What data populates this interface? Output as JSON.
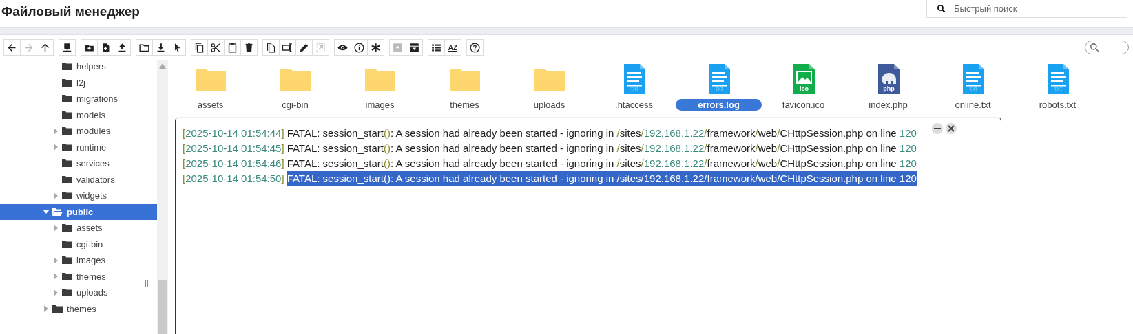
{
  "header": {
    "title": "Файловый менеджер",
    "search": {
      "placeholder": "Быстрый поиск"
    }
  },
  "toolbar": {
    "groups": [
      [
        {
          "kind": "back",
          "disabled": false
        },
        {
          "kind": "forward",
          "disabled": true
        },
        {
          "kind": "up",
          "disabled": false
        }
      ],
      [
        {
          "kind": "network",
          "disabled": false
        }
      ],
      [
        {
          "kind": "new-folder",
          "disabled": false
        },
        {
          "kind": "new-file",
          "disabled": false
        },
        {
          "kind": "upload",
          "disabled": false
        }
      ],
      [
        {
          "kind": "open",
          "disabled": false
        },
        {
          "kind": "download",
          "disabled": false
        },
        {
          "kind": "select",
          "disabled": false
        }
      ],
      [
        {
          "kind": "copy",
          "disabled": false
        },
        {
          "kind": "cut",
          "disabled": false
        },
        {
          "kind": "paste",
          "disabled": false
        },
        {
          "kind": "delete",
          "disabled": false
        }
      ],
      [
        {
          "kind": "duplicate",
          "disabled": false
        },
        {
          "kind": "rename",
          "disabled": false
        },
        {
          "kind": "edit",
          "disabled": false
        },
        {
          "kind": "resize",
          "disabled": true
        }
      ],
      [
        {
          "kind": "view",
          "disabled": false
        },
        {
          "kind": "info",
          "disabled": false
        },
        {
          "kind": "asterisk",
          "disabled": false
        }
      ],
      [
        {
          "kind": "archive",
          "disabled": true
        },
        {
          "kind": "extract",
          "disabled": false
        }
      ],
      [
        {
          "kind": "list",
          "disabled": false
        },
        {
          "kind": "sort",
          "label": "AZ",
          "disabled": false
        }
      ],
      [
        {
          "kind": "help",
          "disabled": false
        }
      ]
    ]
  },
  "tree": {
    "items": [
      {
        "children": [
          {
            "label": "helpers",
            "expandable": false,
            "expanded": false,
            "selected": false
          },
          {
            "label": "l2j",
            "expandable": false,
            "expanded": false,
            "selected": false
          },
          {
            "label": "migrations",
            "expandable": false,
            "expanded": false,
            "selected": false
          },
          {
            "label": "models",
            "expandable": false,
            "expanded": false,
            "selected": false
          },
          {
            "label": "modules",
            "expandable": true,
            "expanded": false,
            "selected": false
          },
          {
            "label": "runtime",
            "expandable": true,
            "expanded": false,
            "selected": false
          },
          {
            "label": "services",
            "expandable": false,
            "expanded": false,
            "selected": false
          },
          {
            "label": "validators",
            "expandable": false,
            "expanded": false,
            "selected": false
          },
          {
            "label": "widgets",
            "expandable": true,
            "expanded": false,
            "selected": false
          }
        ]
      },
      {
        "label": "public",
        "expandable": true,
        "expanded": true,
        "selected": true,
        "children": [
          {
            "label": "assets",
            "expandable": true,
            "expanded": false,
            "selected": false
          },
          {
            "label": "cgi-bin",
            "expandable": false,
            "expanded": false,
            "selected": false
          },
          {
            "label": "images",
            "expandable": true,
            "expanded": false,
            "selected": false
          },
          {
            "label": "themes",
            "expandable": true,
            "expanded": false,
            "selected": false
          },
          {
            "label": "uploads",
            "expandable": true,
            "expanded": false,
            "selected": false
          }
        ]
      },
      {
        "label": "themes",
        "expandable": true,
        "expanded": false,
        "selected": false
      }
    ]
  },
  "files": [
    {
      "name": "assets",
      "kind": "folder",
      "selected": false
    },
    {
      "name": "cgi-bin",
      "kind": "folder",
      "selected": false
    },
    {
      "name": "images",
      "kind": "folder",
      "selected": false
    },
    {
      "name": "themes",
      "kind": "folder",
      "selected": false
    },
    {
      "name": "uploads",
      "kind": "folder",
      "selected": false
    },
    {
      "name": ".htaccess",
      "kind": "text",
      "badge": "txt",
      "selected": false
    },
    {
      "name": "errors.log",
      "kind": "text",
      "badge": "txt",
      "selected": true
    },
    {
      "name": "favicon.ico",
      "kind": "image",
      "badge": "ico",
      "selected": false
    },
    {
      "name": "index.php",
      "kind": "php",
      "badge": "php",
      "selected": false
    },
    {
      "name": "online.txt",
      "kind": "text",
      "badge": "txt",
      "selected": false
    },
    {
      "name": "robots.txt",
      "kind": "text",
      "badge": "txt",
      "selected": false
    }
  ],
  "log": {
    "lines": [
      {
        "time": "[2025-10-14 01:54:44]",
        "message": "FATAL: session_start(): A session had already been started - ignoring in /sites/192.168.1.22/framework/web/CHttpSession.php on line 120",
        "selected": false
      },
      {
        "time": "[2025-10-14 01:54:45]",
        "message": "FATAL: session_start(): A session had already been started - ignoring in /sites/192.168.1.22/framework/web/CHttpSession.php on line 120",
        "selected": false
      },
      {
        "time": "[2025-10-14 01:54:46]",
        "message": "FATAL: session_start(): A session had already been started - ignoring in /sites/192.168.1.22/framework/web/CHttpSession.php on line 120",
        "selected": false
      },
      {
        "time": "[2025-10-14 01:54:50]",
        "message": "FATAL: session_start(): A session had already been started - ignoring in /sites/192.168.1.22/framework/web/CHttpSession.php on line 120",
        "selected": true
      }
    ]
  }
}
